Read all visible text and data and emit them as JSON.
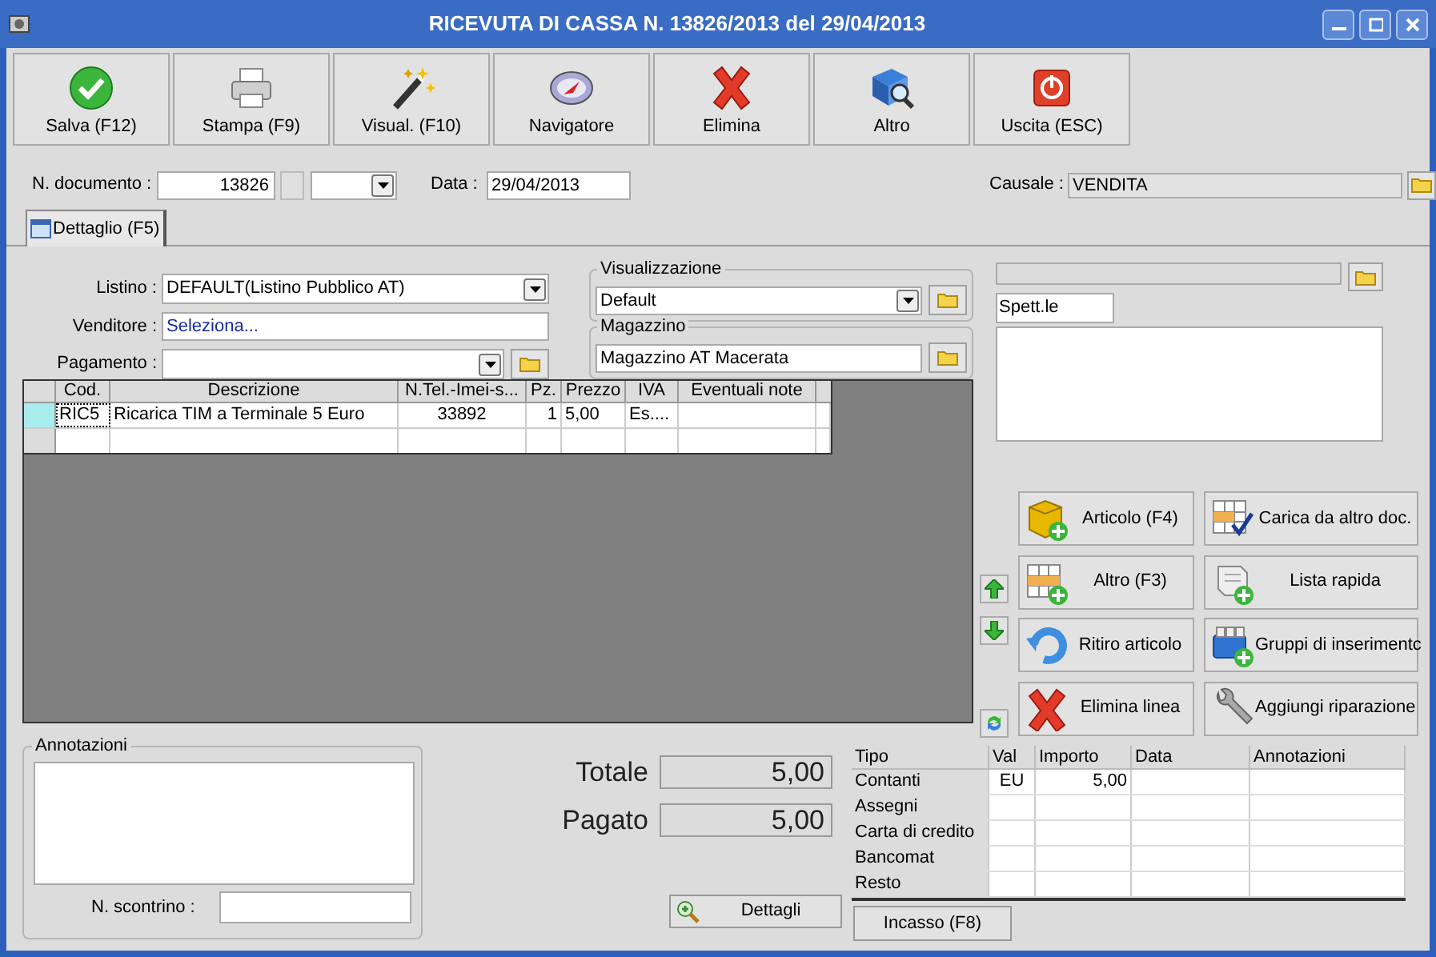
{
  "window": {
    "title": "RICEVUTA DI CASSA N. 13826/2013 del 29/04/2013"
  },
  "toolbar": [
    {
      "label": "Salva (F12)"
    },
    {
      "label": "Stampa (F9)"
    },
    {
      "label": "Visual. (F10)"
    },
    {
      "label": "Navigatore"
    },
    {
      "label": "Elimina"
    },
    {
      "label": "Altro"
    },
    {
      "label": "Uscita (ESC)"
    }
  ],
  "document": {
    "number_label": "N. documento :",
    "number": "13826",
    "date_label": "Data :",
    "date": "29/04/2013",
    "causale_label": "Causale :",
    "causale": "VENDITA"
  },
  "tabs": [
    {
      "label": "Dettaglio (F5)",
      "selected": true
    }
  ],
  "form": {
    "listino_label": "Listino :",
    "listino": "DEFAULT(Listino Pubblico AT)",
    "venditore_label": "Venditore :",
    "venditore_placeholder": "Seleziona...",
    "pagamento_label": "Pagamento :"
  },
  "visualizzazione": {
    "legend": "Visualizzazione",
    "value": "Default"
  },
  "magazzino": {
    "legend": "Magazzino",
    "value": "Magazzino AT Macerata"
  },
  "recipient": {
    "salutation": "Spett.le"
  },
  "lines": {
    "columns": [
      "Cod.",
      "Descrizione",
      "N.Tel.-Imei-s...",
      "Pz.",
      "Prezzo",
      "IVA",
      "Eventuali note"
    ],
    "rows": [
      {
        "selected": true,
        "cells": [
          "RIC5",
          "Ricarica TIM a Terminale 5 Euro",
          "33892",
          "1",
          "5,00",
          "Es...."
        ]
      }
    ]
  },
  "actions": [
    {
      "label": "Articolo (F4)"
    },
    {
      "label": "Carica da altro doc."
    },
    {
      "label": "Altro (F3)"
    },
    {
      "label": "Lista rapida"
    },
    {
      "label": "Ritiro articolo"
    },
    {
      "label": "Gruppi di inserimentc"
    },
    {
      "label": "Elimina linea"
    },
    {
      "label": "Aggiungi riparazione"
    }
  ],
  "annotazioni": {
    "legend": "Annotazioni",
    "scontrino_label": "N. scontrino :"
  },
  "totals": [
    {
      "label": "Totale",
      "value": "5,00"
    },
    {
      "label": "Pagato",
      "value": "5,00"
    }
  ],
  "dettagli_button": "Dettagli",
  "payments": {
    "columns": [
      "Tipo",
      "Val",
      "Importo",
      "Data",
      "Annotazioni"
    ],
    "rows": [
      {
        "cells": [
          "Contanti",
          "EU",
          "5,00"
        ]
      },
      {
        "cells": [
          "Assegni"
        ]
      },
      {
        "cells": [
          "Carta di credito"
        ]
      },
      {
        "cells": [
          "Bancomat"
        ]
      },
      {
        "cells": [
          "Resto"
        ]
      }
    ]
  },
  "incasso_button": "Incasso (F8)"
}
